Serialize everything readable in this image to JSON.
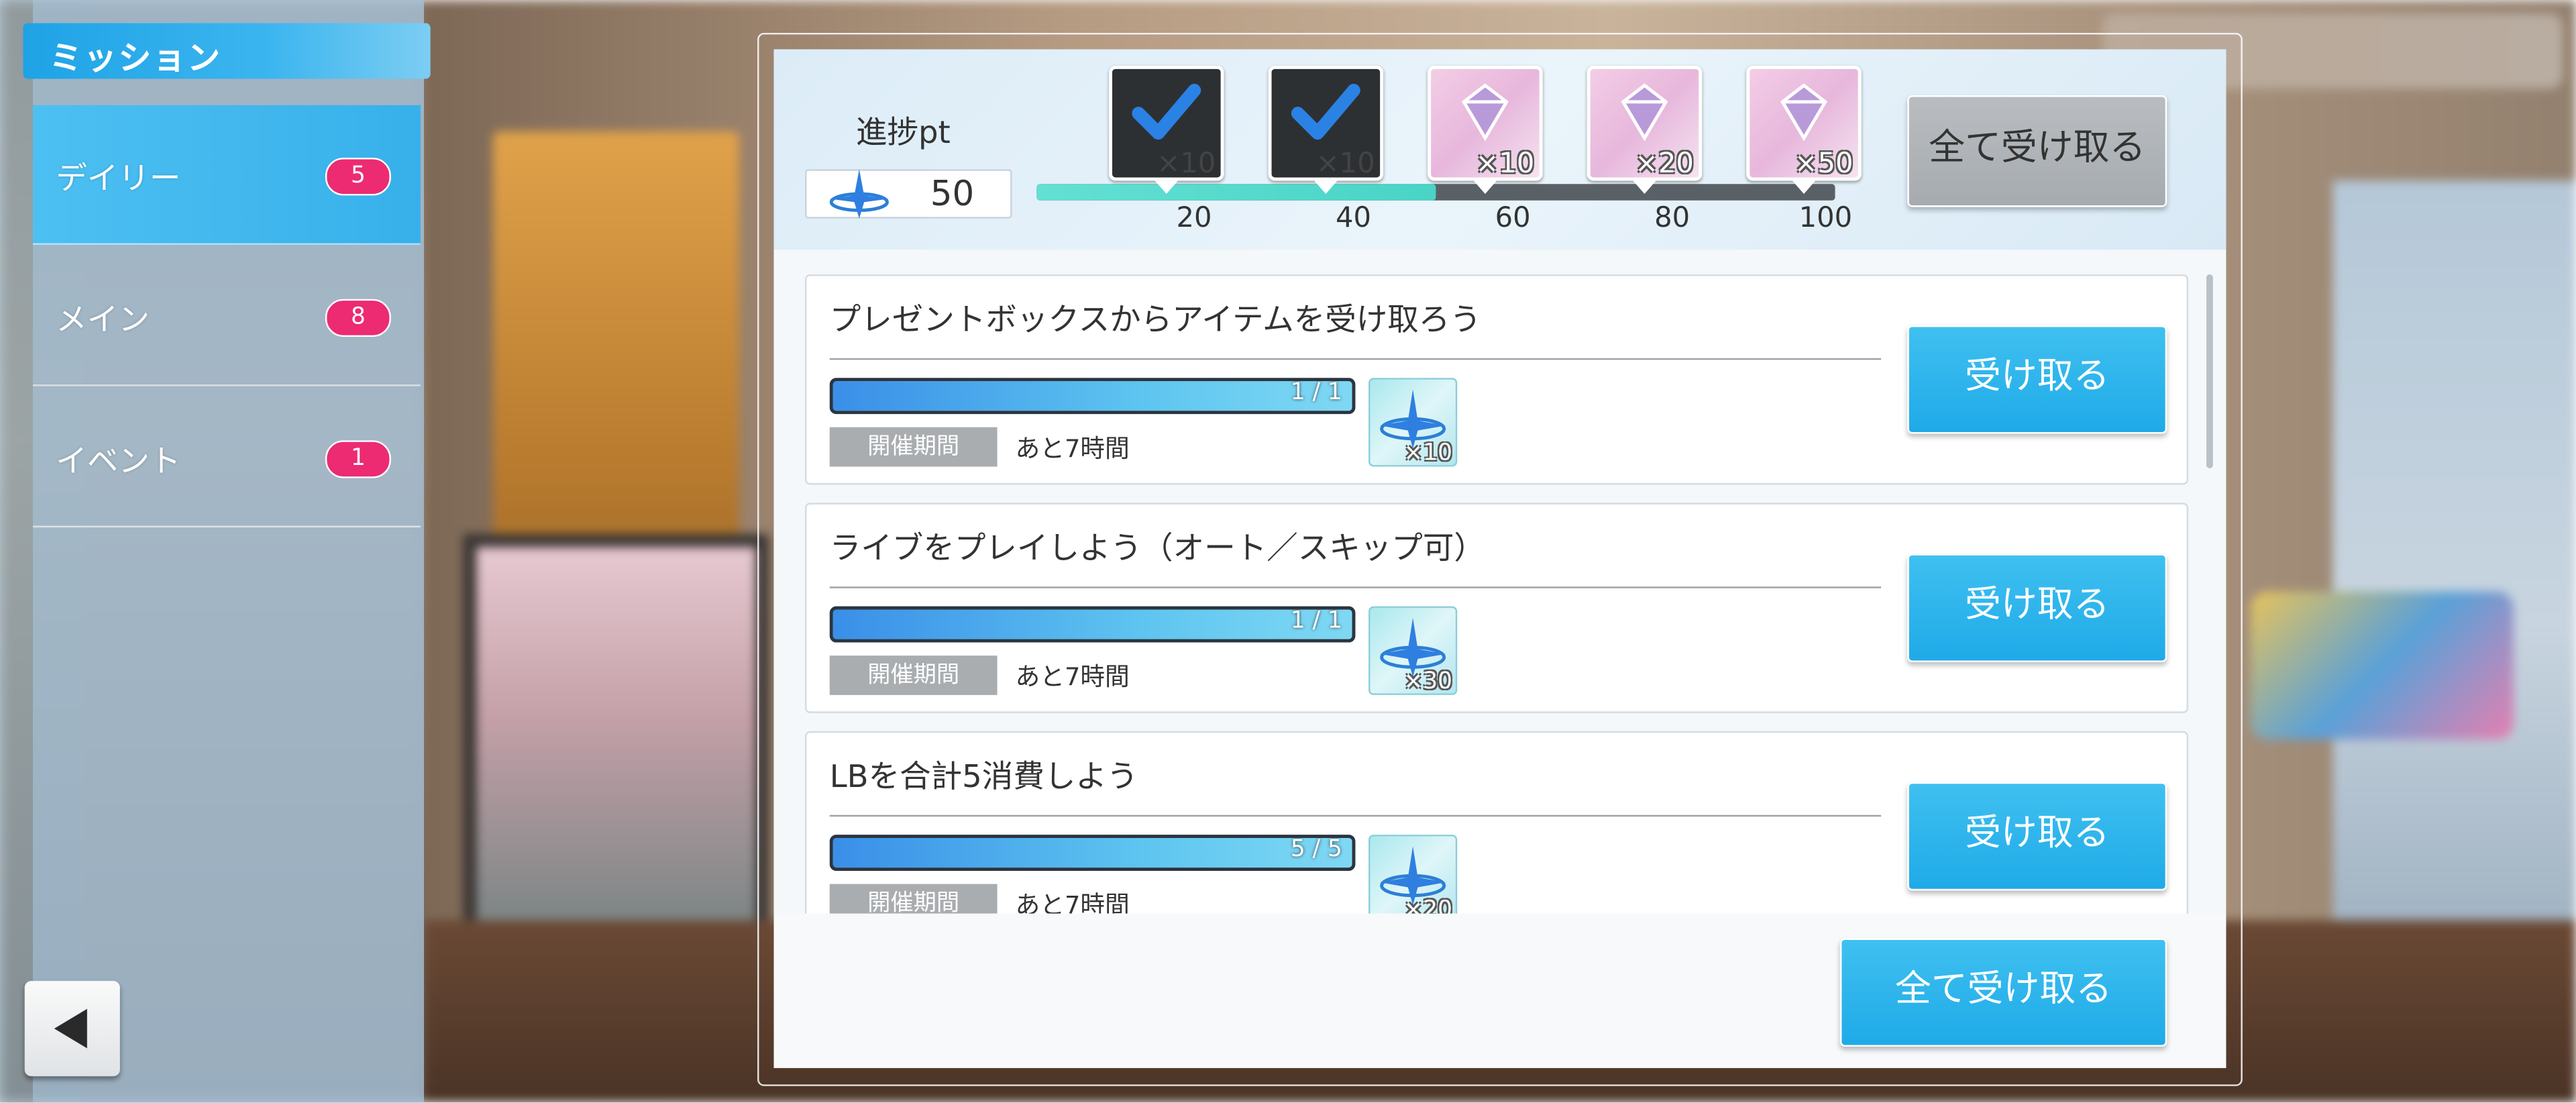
{
  "sidebar": {
    "title": "ミッション",
    "items": [
      {
        "label": "デイリー",
        "badge": "5"
      },
      {
        "label": "メイン",
        "badge": "8"
      },
      {
        "label": "イベント",
        "badge": "1"
      }
    ]
  },
  "header": {
    "pt_label": "進捗pt",
    "pt_value": "50",
    "progress_fraction": 0.5,
    "ticks": [
      "20",
      "40",
      "60",
      "80",
      "100"
    ],
    "rewards": [
      {
        "qty": "×10",
        "claimed": true
      },
      {
        "qty": "×10",
        "claimed": true
      },
      {
        "qty": "×10",
        "claimed": false
      },
      {
        "qty": "×20",
        "claimed": false
      },
      {
        "qty": "×50",
        "claimed": false
      }
    ],
    "claim_all_label": "全て受け取る"
  },
  "missions": [
    {
      "title": "プレゼントボックスからアイテムを受け取ろう",
      "progress": "1 / 1",
      "period_tag": "開催期間",
      "remaining": "あと7時間",
      "reward_qty": "×10",
      "button": "受け取る"
    },
    {
      "title": "ライブをプレイしよう（オート／スキップ可）",
      "progress": "1 / 1",
      "period_tag": "開催期間",
      "remaining": "あと7時間",
      "reward_qty": "×30",
      "button": "受け取る"
    },
    {
      "title": "LBを合計5消費しよう",
      "progress": "5 / 5",
      "period_tag": "開催期間",
      "remaining": "あと7時間",
      "reward_qty": "×20",
      "button": "受け取る"
    }
  ],
  "footer": {
    "claim_all_label": "全て受け取る"
  },
  "colors": {
    "accent": "#1faae8",
    "badge": "#ec2b72",
    "track_fill": "#49d4c6"
  }
}
